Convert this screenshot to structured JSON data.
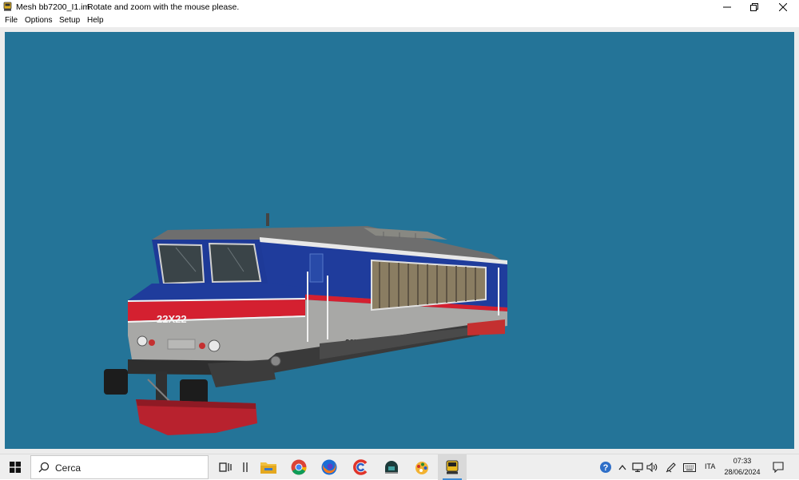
{
  "window": {
    "title": "Mesh bb7200_I1.im",
    "hint": "Rotate and zoom with the mouse please."
  },
  "menu": {
    "items": [
      "File",
      "Options",
      "Setup",
      "Help"
    ]
  },
  "model": {
    "number_front": "22X22",
    "number_side": "22X22"
  },
  "taskbar": {
    "search_placeholder": "Cerca",
    "language": "ITA",
    "time": "07:33",
    "date": "28/06/2024"
  },
  "colors": {
    "canvas_background": "#247498",
    "livery_blue": "#1f3c9c",
    "livery_red": "#d42030",
    "livery_grey": "#a8a8a6"
  },
  "icons": {
    "taskbar": [
      "file-explorer-icon",
      "chrome-icon",
      "firefox-icon",
      "ccleaner-icon",
      "app-icon",
      "paint-icon",
      "train-app-icon"
    ],
    "tray": [
      "help-icon",
      "chevron-up-icon",
      "network-icon",
      "volume-icon",
      "pen-icon",
      "keyboard-icon"
    ]
  }
}
